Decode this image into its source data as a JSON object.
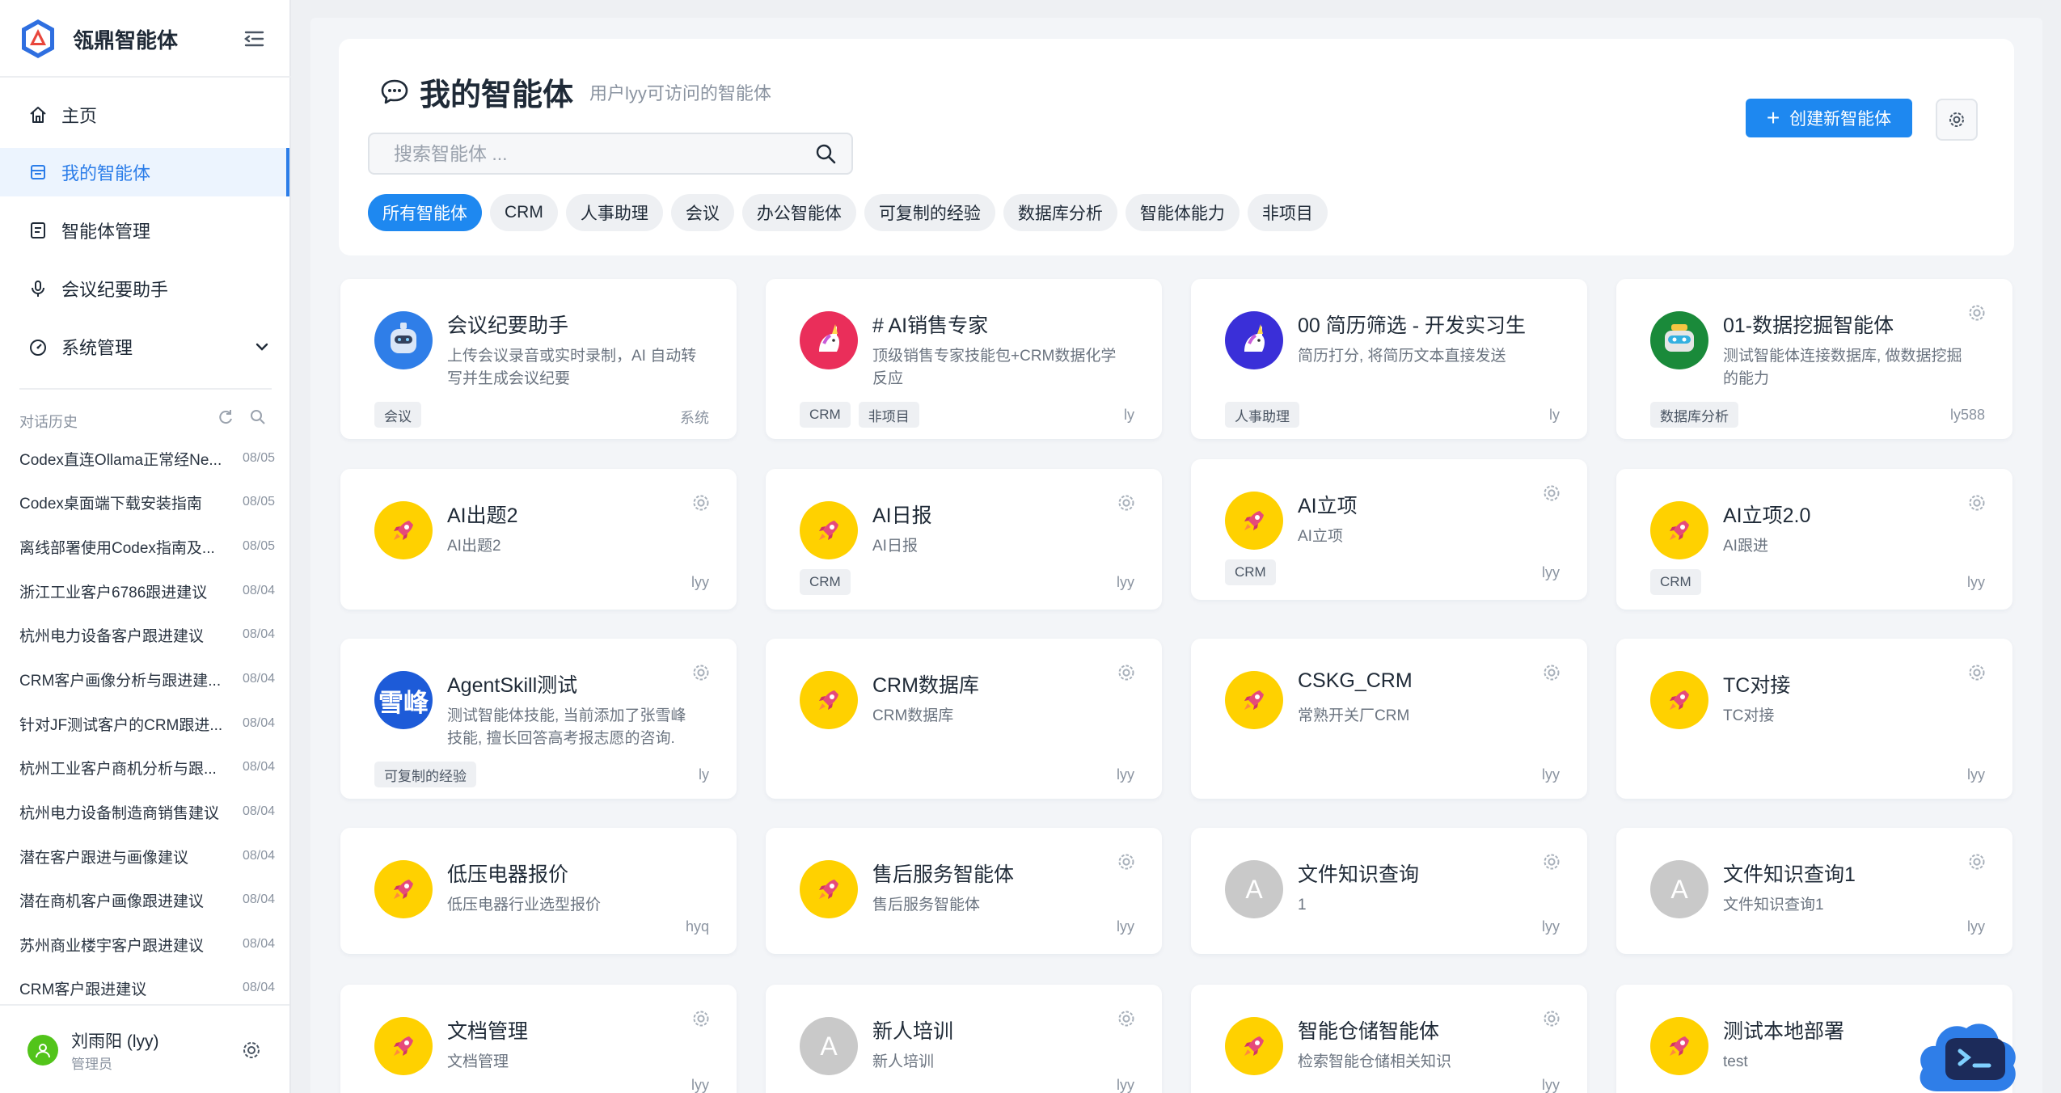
{
  "brand": {
    "name": "瓴鼎智能体"
  },
  "nav": [
    {
      "label": "主页",
      "icon": "home-icon"
    },
    {
      "label": "我的智能体",
      "icon": "agent-list-icon",
      "active": true
    },
    {
      "label": "智能体管理",
      "icon": "manage-icon"
    },
    {
      "label": "会议纪要助手",
      "icon": "microphone-icon"
    },
    {
      "label": "系统管理",
      "icon": "dashboard-icon",
      "expandable": true
    }
  ],
  "history": {
    "title": "对话历史",
    "items": [
      {
        "title": "Codex直连Ollama正常经Ne...",
        "date": "08/05"
      },
      {
        "title": "Codex桌面端下载安装指南",
        "date": "08/05"
      },
      {
        "title": "离线部署使用Codex指南及...",
        "date": "08/05"
      },
      {
        "title": "浙江工业客户6786跟进建议",
        "date": "08/04"
      },
      {
        "title": "杭州电力设备客户跟进建议",
        "date": "08/04"
      },
      {
        "title": "CRM客户画像分析与跟进建...",
        "date": "08/04"
      },
      {
        "title": "针对JF测试客户的CRM跟进...",
        "date": "08/04"
      },
      {
        "title": "杭州工业客户商机分析与跟...",
        "date": "08/04"
      },
      {
        "title": "杭州电力设备制造商销售建议",
        "date": "08/04"
      },
      {
        "title": "潜在客户跟进与画像建议",
        "date": "08/04"
      },
      {
        "title": "潜在商机客户画像跟进建议",
        "date": "08/04"
      },
      {
        "title": "苏州商业楼宇客户跟进建议",
        "date": "08/04"
      },
      {
        "title": "CRM客户跟进建议",
        "date": "08/04"
      }
    ]
  },
  "user": {
    "name": "刘雨阳 (lyy)",
    "role": "管理员"
  },
  "header": {
    "title": "我的智能体",
    "subtitle": "用户lyy可访问的智能体",
    "search_placeholder": "搜索智能体 ...",
    "create_label": "创建新智能体"
  },
  "filters": [
    "所有智能体",
    "CRM",
    "人事助理",
    "会议",
    "办公智能体",
    "可复制的经验",
    "数据库分析",
    "智能体能力",
    "非项目"
  ],
  "agents": [
    {
      "title": "会议纪要助手",
      "desc": "上传会议录音或实时录制，AI 自动转写并生成会议纪要",
      "tags": [
        "会议"
      ],
      "owner": "系统",
      "avatar": "robot-avatar",
      "gear": false
    },
    {
      "title": "# AI销售专家",
      "desc": "顶级销售专家技能包+CRM数据化学反应",
      "tags": [
        "CRM",
        "非项目"
      ],
      "owner": "ly",
      "avatar": "unicorn-pink-avatar",
      "gear": false
    },
    {
      "title": "00 简历筛选 - 开发实习生",
      "desc": "简历打分, 将简历文本直接发送",
      "tags": [
        "人事助理"
      ],
      "owner": "ly",
      "avatar": "unicorn-blue-avatar",
      "gear": false
    },
    {
      "title": "01-数据挖掘智能体",
      "desc": "测试智能体连接数据库, 做数据挖掘的能力",
      "tags": [
        "数据库分析"
      ],
      "owner": "ly588",
      "avatar": "robot-green-avatar",
      "gear": true
    },
    {
      "title": "AI出题2",
      "desc": "AI出题2",
      "tags": [],
      "owner": "lyy",
      "avatar": "rocket-avatar",
      "gear": true
    },
    {
      "title": "AI日报",
      "desc": "AI日报",
      "tags": [
        "CRM"
      ],
      "owner": "lyy",
      "avatar": "rocket-avatar",
      "gear": true
    },
    {
      "title": "AI立项",
      "desc": "AI立项",
      "tags": [
        "CRM"
      ],
      "owner": "lyy",
      "avatar": "rocket-avatar",
      "gear": true
    },
    {
      "title": "AI立项2.0",
      "desc": "AI跟进",
      "tags": [
        "CRM"
      ],
      "owner": "lyy",
      "avatar": "rocket-avatar",
      "gear": true
    },
    {
      "title": "AgentSkill测试",
      "desc": "测试智能体技能, 当前添加了张雪峰技能, 擅长回答高考报志愿的咨询.",
      "tags": [
        "可复制的经验"
      ],
      "owner": "ly",
      "avatar": "text-avatar",
      "avatar_text": "雪峰",
      "gear": true
    },
    {
      "title": "CRM数据库",
      "desc": "CRM数据库",
      "tags": [],
      "owner": "lyy",
      "avatar": "rocket-avatar",
      "gear": true
    },
    {
      "title": "CSKG_CRM",
      "desc": "常熟开关厂CRM",
      "tags": [],
      "owner": "lyy",
      "avatar": "rocket-avatar",
      "gear": true
    },
    {
      "title": "TC对接",
      "desc": "TC对接",
      "tags": [],
      "owner": "lyy",
      "avatar": "rocket-avatar",
      "gear": true
    },
    {
      "title": "低压电器报价",
      "desc": "低压电器行业选型报价",
      "tags": [],
      "owner": "hyq",
      "avatar": "rocket-avatar",
      "gear": false
    },
    {
      "title": "售后服务智能体",
      "desc": "售后服务智能体",
      "tags": [],
      "owner": "lyy",
      "avatar": "rocket-avatar",
      "gear": true
    },
    {
      "title": "文件知识查询",
      "desc": "1",
      "tags": [],
      "owner": "lyy",
      "avatar": "letter-avatar",
      "avatar_text": "A",
      "gear": true
    },
    {
      "title": "文件知识查询1",
      "desc": "文件知识查询1",
      "tags": [],
      "owner": "lyy",
      "avatar": "letter-avatar",
      "avatar_text": "A",
      "gear": true
    },
    {
      "title": "文档管理",
      "desc": "文档管理",
      "tags": [],
      "owner": "lyy",
      "avatar": "rocket-avatar",
      "gear": true
    },
    {
      "title": "新人培训",
      "desc": "新人培训",
      "tags": [],
      "owner": "lyy",
      "avatar": "letter-avatar",
      "avatar_text": "A",
      "gear": true
    },
    {
      "title": "智能仓储智能体",
      "desc": "检索智能仓储相关知识",
      "tags": [],
      "owner": "lyy",
      "avatar": "rocket-avatar",
      "gear": true
    },
    {
      "title": "测试本地部署",
      "desc": "test",
      "tags": [],
      "owner": "",
      "avatar": "rocket-avatar",
      "gear": false
    }
  ],
  "colors": {
    "accent": "#1e88f0",
    "active_nav_bg": "#ecf4fe",
    "rocket_bg": "#ffd100"
  }
}
